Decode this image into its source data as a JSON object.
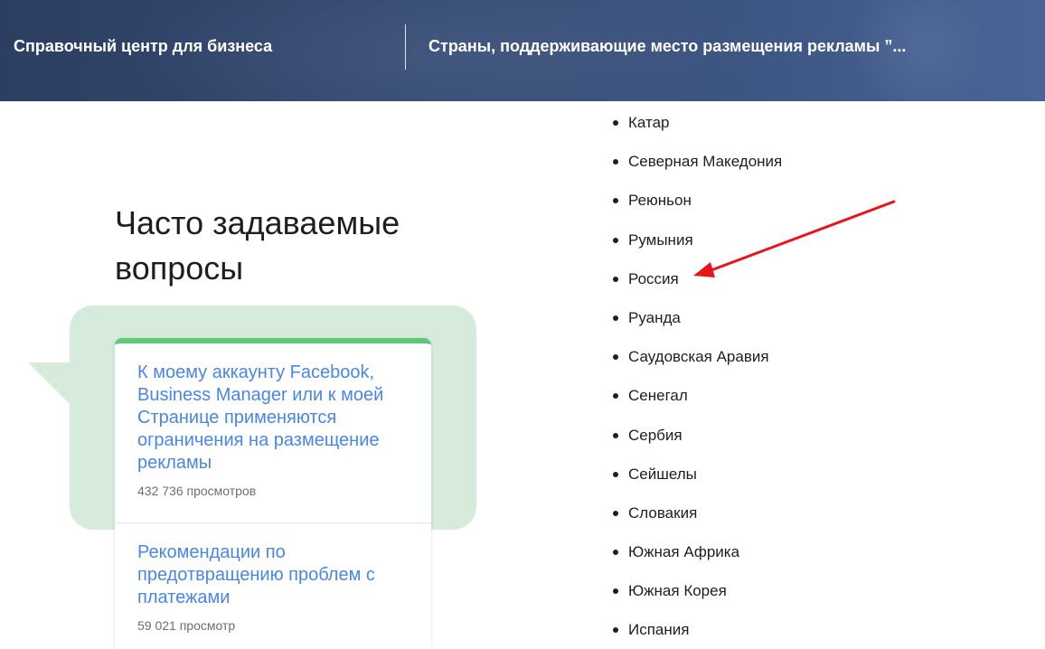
{
  "header": {
    "brand": "Справочный центр для бизнеса",
    "page_title": "Страны, поддерживающие место размещения рекламы ”..."
  },
  "faq": {
    "heading": "Часто задаваемые вопросы",
    "cards": [
      {
        "title": "К моему аккаунту Facebook, Business Manager или к моей Странице применяются ограничения на размещение рекламы",
        "views": "432 736 просмотров"
      },
      {
        "title": "Рекомендации по предотвращению проблем с платежами",
        "views": "59 021 просмотр"
      }
    ]
  },
  "countries": [
    "Катар",
    "Северная Македония",
    "Реюньон",
    "Румыния",
    "Россия",
    "Руанда",
    "Саудовская Аравия",
    "Сенегал",
    "Сербия",
    "Сейшелы",
    "Словакия",
    "Южная Африка",
    "Южная Корея",
    "Испания"
  ],
  "colors": {
    "header": "#34496f",
    "accent_green": "#5ec97a",
    "bubble": "#d6ebdb",
    "link_blue": "#4a86e8",
    "annotation_arrow": "#e8141b"
  }
}
